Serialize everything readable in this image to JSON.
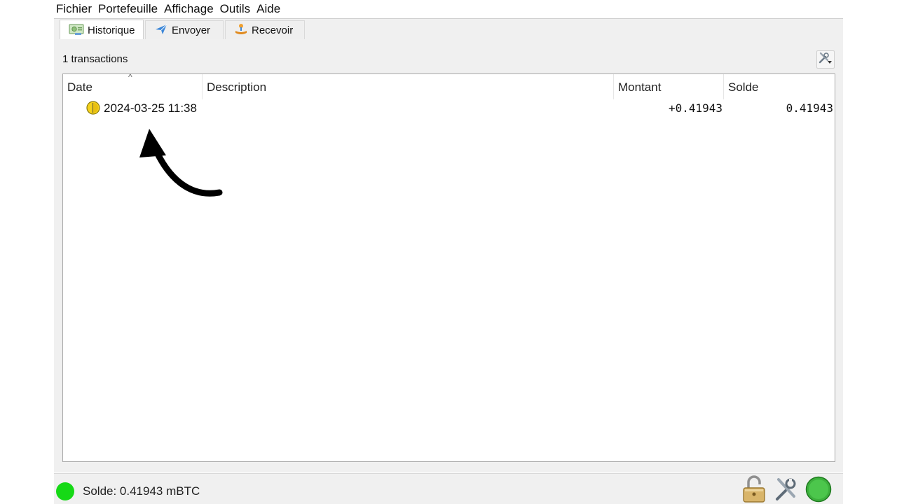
{
  "menubar": {
    "items": [
      "Fichier",
      "Portefeuille",
      "Affichage",
      "Outils",
      "Aide"
    ]
  },
  "tabs": [
    {
      "label": "Historique",
      "icon": "history-icon",
      "active": true
    },
    {
      "label": "Envoyer",
      "icon": "send-icon",
      "active": false
    },
    {
      "label": "Recevoir",
      "icon": "receive-icon",
      "active": false
    }
  ],
  "history": {
    "count_label": "1 transactions",
    "columns": [
      "Date",
      "Description",
      "Montant",
      "Solde"
    ],
    "sort_indicator": "^",
    "rows": [
      {
        "status_icon": "unconfirmed-clock-icon",
        "date": "2024-03-25 11:38",
        "description": "",
        "montant": "+0.41943",
        "solde": "0.41943"
      }
    ]
  },
  "statusbar": {
    "balance_label": "Solde: 0.41943 mBTC",
    "status_color": "#16d916",
    "icons": [
      "lock-icon",
      "preferences-icon",
      "network-status-icon"
    ]
  }
}
